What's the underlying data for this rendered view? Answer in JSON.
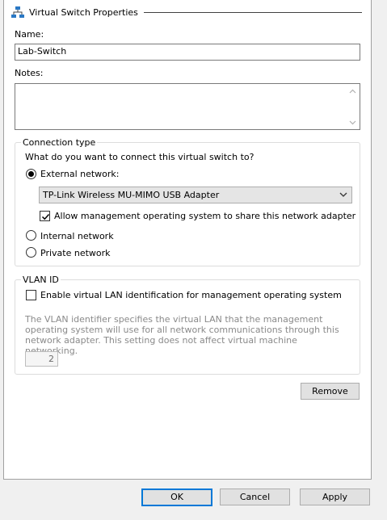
{
  "header": {
    "title": "Virtual Switch Properties",
    "icon": "network-switch-icon"
  },
  "name_field": {
    "label": "Name:",
    "value": "Lab-Switch"
  },
  "notes_field": {
    "label": "Notes:",
    "value": ""
  },
  "connection_type": {
    "legend": "Connection type",
    "question": "What do you want to connect this virtual switch to?",
    "external": {
      "label": "External network:",
      "selected": true
    },
    "adapter": {
      "value": "TP-Link Wireless MU-MIMO USB Adapter"
    },
    "allow_mgmt": {
      "label": "Allow management operating system to share this network adapter",
      "checked": true
    },
    "internal": {
      "label": "Internal network",
      "selected": false
    },
    "private": {
      "label": "Private network",
      "selected": false
    }
  },
  "vlan": {
    "legend": "VLAN ID",
    "enable_label": "Enable virtual LAN identification for management operating system",
    "enable_checked": false,
    "description": "The VLAN identifier specifies the virtual LAN that the management operating system will use for all network communications through this network adapter. This setting does not affect virtual machine networking.",
    "value": "2"
  },
  "remove_button": "Remove",
  "footer": {
    "ok": "OK",
    "cancel": "Cancel",
    "apply": "Apply"
  },
  "colors": {
    "accent": "#0078d7",
    "disabled_text": "#8a8a8a"
  }
}
